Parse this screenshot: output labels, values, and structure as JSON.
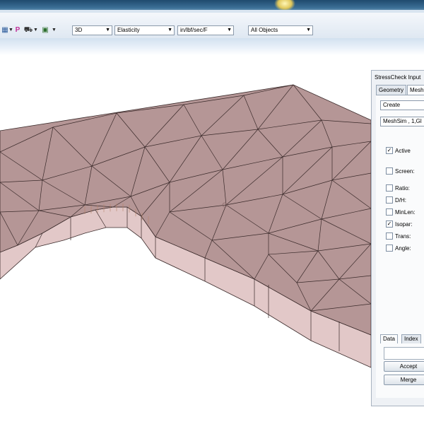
{
  "toolbar": {
    "icons": [
      "toolbar-icon-1",
      "toolbar-icon-2",
      "p-icon",
      "toolbar-icon-4",
      "toolbar-icon-5"
    ],
    "p_label": "P",
    "view_mode": "3D",
    "analysis_type": "Elasticity",
    "units": "in/lbf/sec/F",
    "object_filter": "All Objects"
  },
  "panel": {
    "title": "StressCheck Input",
    "tabs": [
      "Geometry",
      "Mesh"
    ],
    "active_tab": "Mesh",
    "action": "Create",
    "mesh_type": "MeshSim , 1,Gl",
    "checkboxes": [
      {
        "label": "Active",
        "checked": true
      },
      {
        "label": "Screen:",
        "checked": false
      },
      {
        "label": "Ratio:",
        "checked": false
      },
      {
        "label": "D/H:",
        "checked": false
      },
      {
        "label": "MinLen:",
        "checked": false
      },
      {
        "label": "Isopar:",
        "checked": true
      },
      {
        "label": "Trans:",
        "checked": false
      },
      {
        "label": "Angle:",
        "checked": false
      }
    ],
    "bottom_tabs": [
      "Data",
      "Index"
    ],
    "active_bottom_tab": "Data",
    "buttons": {
      "accept": "Accept",
      "merge": "Merge"
    }
  },
  "colors": {
    "mesh_top": "#b59696",
    "mesh_side": "#e2c8c8",
    "mesh_lines": "#3a2a2a"
  }
}
